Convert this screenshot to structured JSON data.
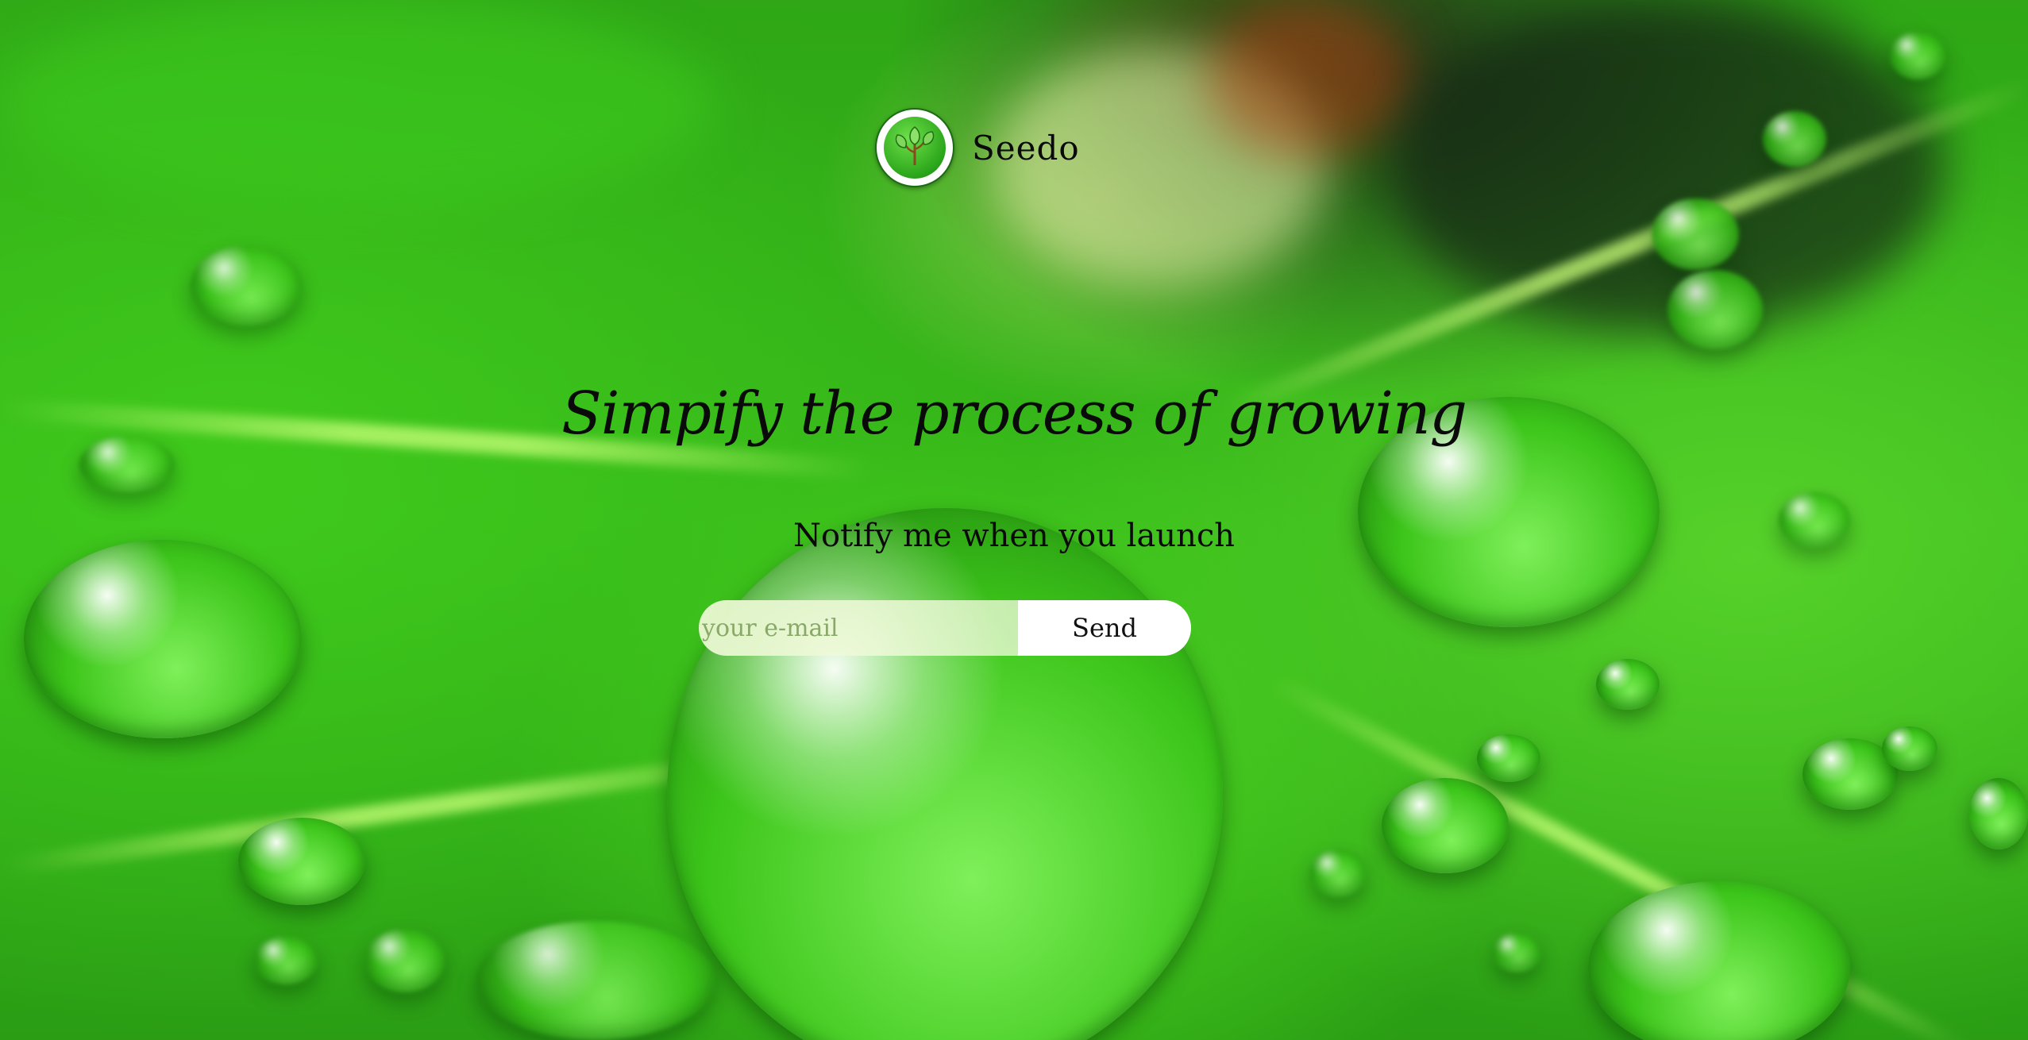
{
  "brand": {
    "name": "Seedo",
    "logo_icon": "seedling-icon"
  },
  "hero": {
    "headline": "Simpify the process of growing",
    "subline": "Notify me when you launch"
  },
  "signup": {
    "email_placeholder": "your e-mail",
    "email_value": "",
    "send_label": "Send"
  },
  "colors": {
    "accent": "#2aa51a",
    "text": "#0a0a0a",
    "button_bg": "#ffffff"
  }
}
